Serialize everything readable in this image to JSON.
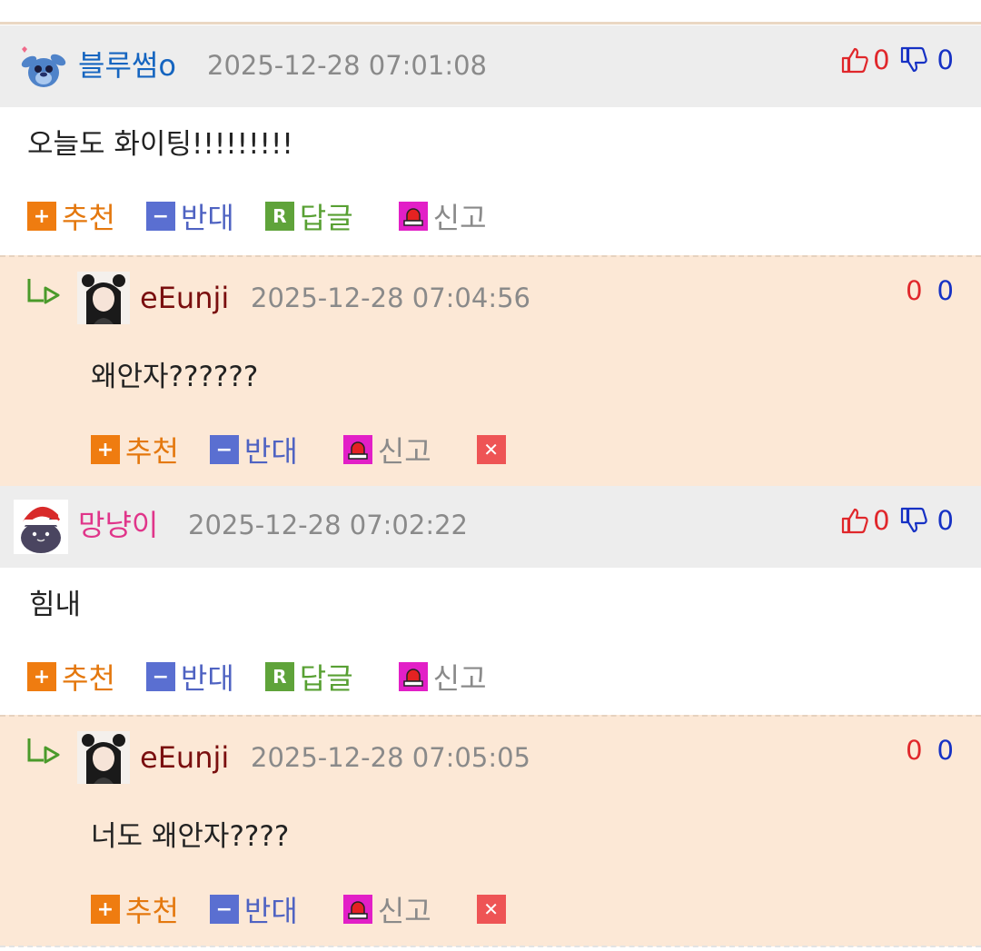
{
  "comments": [
    {
      "nick": "블루썸o",
      "nick_color": "#1565c0",
      "date": "2025-12-28 07:01:08",
      "up": "0",
      "down": "0",
      "text": "오늘도 화이팅!!!!!!!!!",
      "avatar_icon": "stitch-avatar-icon",
      "replies": [
        {
          "nick": "eEunji",
          "nick_color": "#7a0f0f",
          "date": "2025-12-28 07:04:56",
          "up": "0",
          "down": "0",
          "text": "왜안자??????",
          "avatar_icon": "anime-girl-avatar-icon"
        }
      ]
    },
    {
      "nick": "망냥이",
      "nick_color": "#e0358a",
      "date": "2025-12-28 07:02:22",
      "up": "0",
      "down": "0",
      "text": "힘내",
      "avatar_icon": "santa-cat-avatar-icon",
      "replies": [
        {
          "nick": "eEunji",
          "nick_color": "#7a0f0f",
          "date": "2025-12-28 07:05:05",
          "up": "0",
          "down": "0",
          "text": "너도 왜안자????",
          "avatar_icon": "anime-girl-avatar-icon"
        }
      ]
    }
  ],
  "actions": {
    "recommend": "추천",
    "oppose": "반대",
    "reply": "답글",
    "report": "신고",
    "recommend_icon": "+",
    "oppose_icon": "−",
    "reply_icon": "R",
    "delete_icon": "✕"
  },
  "colors": {
    "header_bg": "#ededed",
    "reply_bg": "#fce8d6",
    "up_red": "#e0272b",
    "down_blue": "#1631c4"
  }
}
